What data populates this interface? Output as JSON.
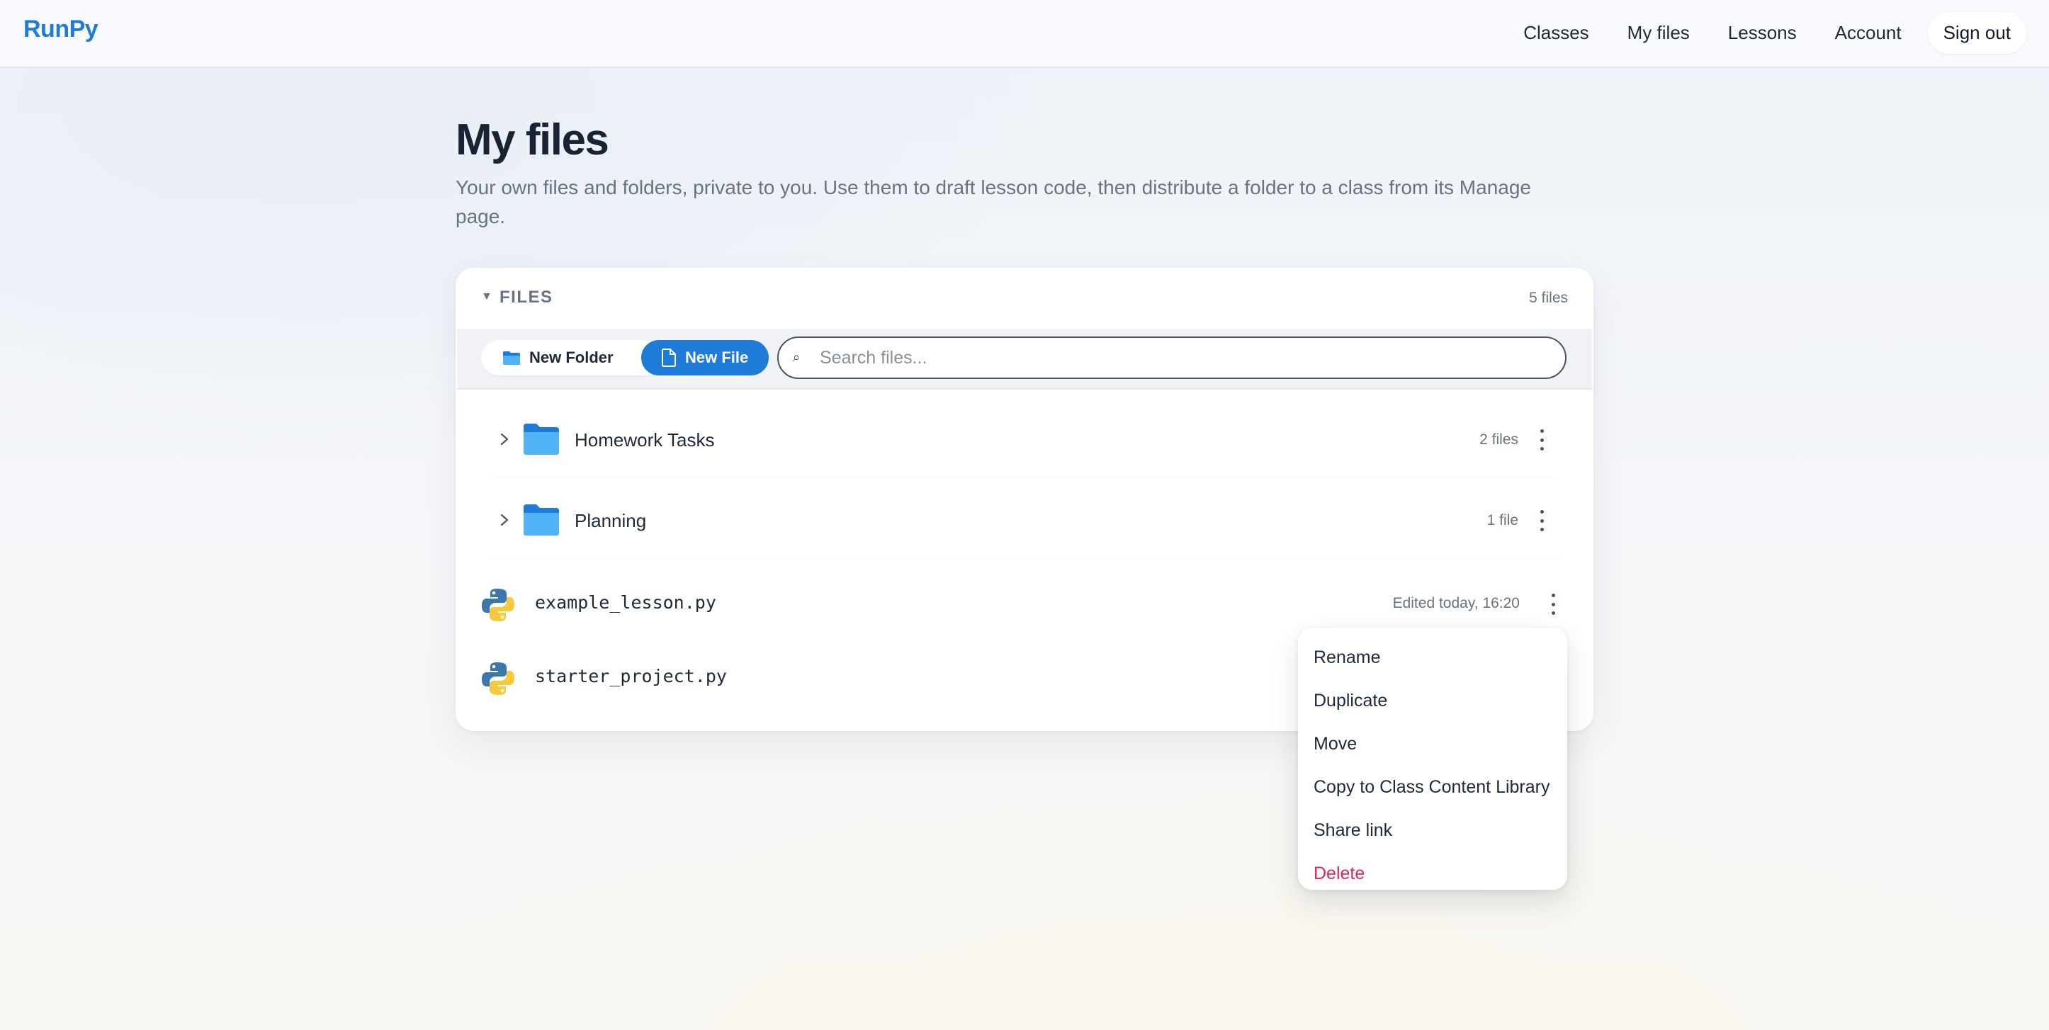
{
  "brand": "RunPy",
  "nav": {
    "items": [
      "Classes",
      "My files",
      "Lessons",
      "Account"
    ],
    "sign_out": "Sign out"
  },
  "page": {
    "title": "My files",
    "description": "Your own files and folders, private to you. Use them to draft lesson code, then distribute a folder to a class from its Manage page."
  },
  "panel": {
    "title": "FILES",
    "count": "5 files",
    "toolbar": {
      "new_folder": "New Folder",
      "new_file": "New File",
      "search_placeholder": "Search files..."
    },
    "folders": [
      {
        "name": "Homework Tasks",
        "meta": "2 files"
      },
      {
        "name": "Planning",
        "meta": "1 file"
      }
    ],
    "files": [
      {
        "name": "example_lesson.py",
        "meta": "Edited today, 16:20"
      },
      {
        "name": "starter_project.py",
        "meta": ""
      }
    ]
  },
  "context_menu": {
    "items": [
      "Rename",
      "Duplicate",
      "Move",
      "Copy to Class Content Library",
      "Share link"
    ],
    "delete": "Delete"
  },
  "colors": {
    "accent": "#1e7bd8",
    "danger": "#e0245e",
    "folder": "#4fb3f6"
  }
}
